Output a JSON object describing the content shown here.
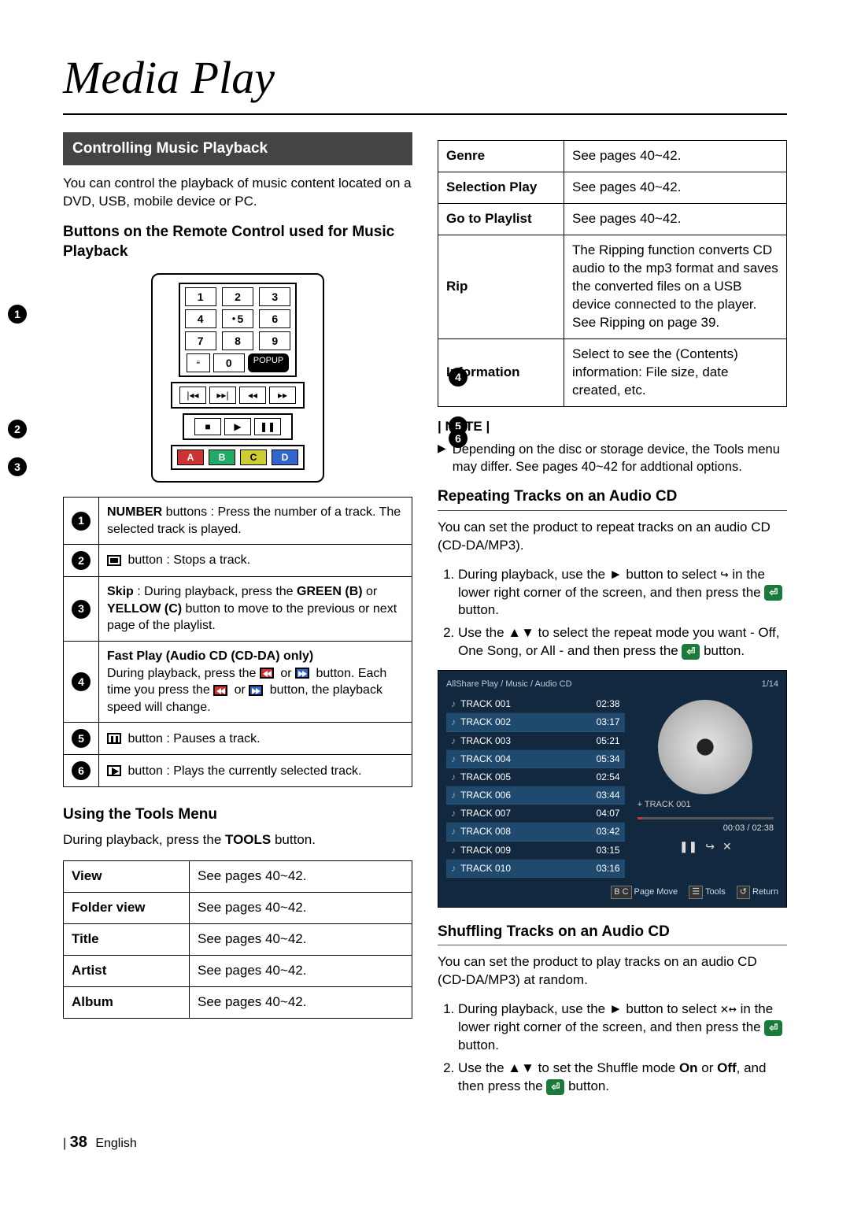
{
  "page_title": "Media Play",
  "section_bar": "Controlling Music Playback",
  "intro": "You can control the playback of music content located on a DVD, USB, mobile device or PC.",
  "sub_remote": "Buttons on the Remote Control used for Music Playback",
  "remote": {
    "keys": [
      "1",
      "2",
      "3",
      "4",
      "5",
      "6",
      "7",
      "8",
      "9",
      "0"
    ],
    "popup": "POPUP",
    "abcd": [
      "A",
      "B",
      "C",
      "D"
    ]
  },
  "callouts": [
    "1",
    "2",
    "3",
    "4",
    "5",
    "6"
  ],
  "btn_rows": [
    {
      "n": "1",
      "html": "<b>NUMBER</b> buttons : Press the number of a track. The selected track is played."
    },
    {
      "n": "2",
      "html": "<span class='iconbox stop'></span> button : Stops a track."
    },
    {
      "n": "3",
      "html": "<b>Skip</b> : During playback, press the <b>GREEN (B)</b> or <b>YELLOW (C)</b> button to move to the previous or next page of the playlist."
    },
    {
      "n": "4",
      "html": "<b>Fast Play (Audio CD (CD-DA) only)</b><br>During playback, press the <span class='iconbox rew'></span> or <span class='iconbox ffw'></span> button. Each time you press the <span class='iconbox rew'></span> or <span class='iconbox ffw'></span> button, the playback speed will change."
    },
    {
      "n": "5",
      "html": "<span class='iconbox pause'></span> button : Pauses a track."
    },
    {
      "n": "6",
      "html": "<span class='iconbox play'></span> button : Plays the currently selected track."
    }
  ],
  "tools_h": "Using the Tools Menu",
  "tools_intro_pre": "During playback, press the ",
  "tools_intro_bold": "TOOLS",
  "tools_intro_post": " button.",
  "tools_left": [
    {
      "k": "View",
      "v": "See pages 40~42."
    },
    {
      "k": "Folder view",
      "v": "See pages 40~42."
    },
    {
      "k": "Title",
      "v": "See pages 40~42."
    },
    {
      "k": "Artist",
      "v": "See pages 40~42."
    },
    {
      "k": "Album",
      "v": "See pages 40~42."
    }
  ],
  "tools_right": [
    {
      "k": "Genre",
      "v": "See pages 40~42."
    },
    {
      "k": "Selection Play",
      "v": "See pages 40~42."
    },
    {
      "k": "Go to Playlist",
      "v": "See pages 40~42."
    },
    {
      "k": "Rip",
      "v": "The Ripping function converts CD audio to the mp3 format and saves the converted files on a USB device connected to the player. See Ripping on page 39."
    },
    {
      "k": "Information",
      "v": "Select to see the (Contents) information: File size, date created, etc."
    }
  ],
  "note_h": "NOTE",
  "note_text": "Depending on the disc or storage device, the Tools menu may differ. See pages 40~42 for addtional options.",
  "repeat_h": "Repeating Tracks on an Audio CD",
  "repeat_intro": "You can set the product to repeat tracks on an audio CD (CD-DA/MP3).",
  "repeat_steps": [
    "During playback, use the ► button to select <span style='font-family:monospace'>↪</span> in the lower right corner of the screen, and then press the <span class='inline-icon green'>⏎</span> button.",
    "Use the ▲▼ to select the repeat mode you want - Off, One Song, or All - and then press the <span class='inline-icon green'>⏎</span> button."
  ],
  "player": {
    "crumb": "AllShare Play  / Music /     Audio CD",
    "page": "1/14",
    "tracks": [
      {
        "t": "TRACK 001",
        "d": "02:38",
        "sel": false
      },
      {
        "t": "TRACK 002",
        "d": "03:17",
        "sel": true
      },
      {
        "t": "TRACK 003",
        "d": "05:21",
        "sel": false
      },
      {
        "t": "TRACK 004",
        "d": "05:34",
        "sel": true
      },
      {
        "t": "TRACK 005",
        "d": "02:54",
        "sel": false
      },
      {
        "t": "TRACK 006",
        "d": "03:44",
        "sel": true
      },
      {
        "t": "TRACK 007",
        "d": "04:07",
        "sel": false
      },
      {
        "t": "TRACK 008",
        "d": "03:42",
        "sel": true
      },
      {
        "t": "TRACK 009",
        "d": "03:15",
        "sel": false
      },
      {
        "t": "TRACK 010",
        "d": "03:16",
        "sel": true
      }
    ],
    "now": "+ TRACK 001",
    "time": "00:03 / 02:38",
    "legend": [
      {
        "tag": "B C",
        "label": "Page Move"
      },
      {
        "tag": "☰",
        "label": "Tools"
      },
      {
        "tag": "↺",
        "label": "Return"
      }
    ]
  },
  "shuffle_h": "Shuffling Tracks on an Audio CD",
  "shuffle_intro": "You can set the product to play tracks on an audio CD (CD-DA/MP3) at random.",
  "shuffle_steps": [
    "During playback, use the ► button to select <span style='font-family:monospace'>✕↔</span> in the lower right corner of the screen, and then press the <span class='inline-icon green'>⏎</span> button.",
    "Use the ▲▼ to set the Shuffle mode <b>On</b> or <b>Off</b>, and then press the <span class='inline-icon green'>⏎</span> button."
  ],
  "footer_page": "38",
  "footer_lang": "English"
}
